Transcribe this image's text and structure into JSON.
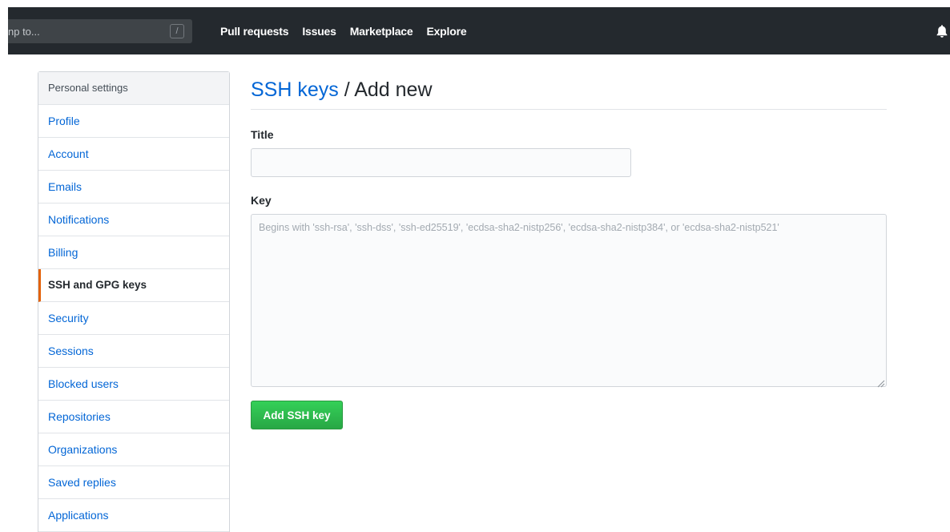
{
  "header": {
    "search_placeholder": "np to...",
    "search_shortcut": "/",
    "nav": [
      "Pull requests",
      "Issues",
      "Marketplace",
      "Explore"
    ],
    "icons": {
      "notifications": "bell-icon"
    }
  },
  "sidebar": {
    "heading": "Personal settings",
    "items": [
      {
        "label": "Profile",
        "selected": false
      },
      {
        "label": "Account",
        "selected": false
      },
      {
        "label": "Emails",
        "selected": false
      },
      {
        "label": "Notifications",
        "selected": false
      },
      {
        "label": "Billing",
        "selected": false
      },
      {
        "label": "SSH and GPG keys",
        "selected": true
      },
      {
        "label": "Security",
        "selected": false
      },
      {
        "label": "Sessions",
        "selected": false
      },
      {
        "label": "Blocked users",
        "selected": false
      },
      {
        "label": "Repositories",
        "selected": false
      },
      {
        "label": "Organizations",
        "selected": false
      },
      {
        "label": "Saved replies",
        "selected": false
      },
      {
        "label": "Applications",
        "selected": false
      }
    ]
  },
  "main": {
    "title_link": "SSH keys",
    "title_rest": " / Add new",
    "title_field": {
      "label": "Title",
      "value": ""
    },
    "key_field": {
      "label": "Key",
      "value": "",
      "placeholder": "Begins with 'ssh-rsa', 'ssh-dss', 'ssh-ed25519', 'ecdsa-sha2-nistp256', 'ecdsa-sha2-nistp384', or 'ecdsa-sha2-nistp521'"
    },
    "submit_label": "Add SSH key"
  },
  "colors": {
    "header_bg": "#24292e",
    "link": "#0366d6",
    "selected_indicator": "#e36209",
    "button_green": "#28a745"
  }
}
